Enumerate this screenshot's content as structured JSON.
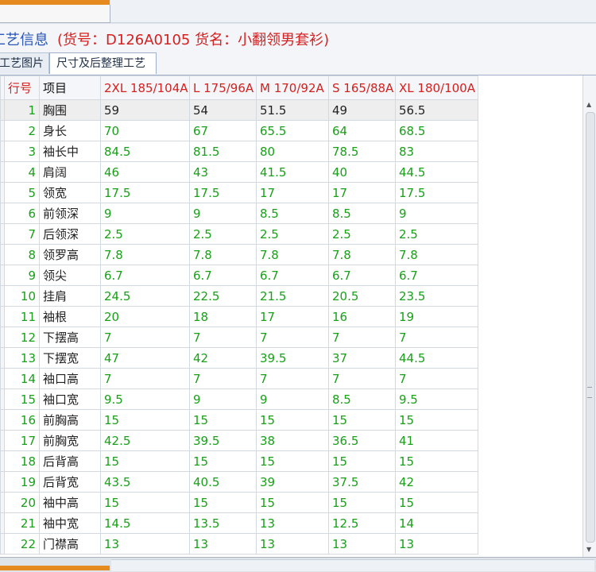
{
  "window": {
    "title_main": "工艺信息",
    "title_sub": "(货号：D126A0105 货名：小翻领男套衫)"
  },
  "tabs": [
    {
      "label": "工艺图片"
    },
    {
      "label": "尺寸及后整理工艺"
    }
  ],
  "grid": {
    "headers": [
      "行号",
      "项目",
      "2XL 185/104A",
      "L 175/96A",
      "M 170/92A",
      "S 165/88A",
      "XL 180/100A"
    ],
    "rows": [
      [
        "1",
        "胸围",
        "59",
        "54",
        "51.5",
        "49",
        "56.5"
      ],
      [
        "2",
        "身长",
        "70",
        "67",
        "65.5",
        "64",
        "68.5"
      ],
      [
        "3",
        "袖长中",
        "84.5",
        "81.5",
        "80",
        "78.5",
        "83"
      ],
      [
        "4",
        "肩阔",
        "46",
        "43",
        "41.5",
        "40",
        "44.5"
      ],
      [
        "5",
        "领宽",
        "17.5",
        "17.5",
        "17",
        "17",
        "17.5"
      ],
      [
        "6",
        "前领深",
        "9",
        "9",
        "8.5",
        "8.5",
        "9"
      ],
      [
        "7",
        "后领深",
        "2.5",
        "2.5",
        "2.5",
        "2.5",
        "2.5"
      ],
      [
        "8",
        "领罗高",
        "7.8",
        "7.8",
        "7.8",
        "7.8",
        "7.8"
      ],
      [
        "9",
        "领尖",
        "6.7",
        "6.7",
        "6.7",
        "6.7",
        "6.7"
      ],
      [
        "10",
        "挂肩",
        "24.5",
        "22.5",
        "21.5",
        "20.5",
        "23.5"
      ],
      [
        "11",
        "袖根",
        "20",
        "18",
        "17",
        "16",
        "19"
      ],
      [
        "12",
        "下摆高",
        "7",
        "7",
        "7",
        "7",
        "7"
      ],
      [
        "13",
        "下摆宽",
        "47",
        "42",
        "39.5",
        "37",
        "44.5"
      ],
      [
        "14",
        "袖口高",
        "7",
        "7",
        "7",
        "7",
        "7"
      ],
      [
        "15",
        "袖口宽",
        "9.5",
        "9",
        "9",
        "8.5",
        "9.5"
      ],
      [
        "16",
        "前胸高",
        "15",
        "15",
        "15",
        "15",
        "15"
      ],
      [
        "17",
        "前胸宽",
        "42.5",
        "39.5",
        "38",
        "36.5",
        "41"
      ],
      [
        "18",
        "后背高",
        "15",
        "15",
        "15",
        "15",
        "15"
      ],
      [
        "19",
        "后背宽",
        "43.5",
        "40.5",
        "39",
        "37.5",
        "42"
      ],
      [
        "20",
        "袖中高",
        "15",
        "15",
        "15",
        "15",
        "15"
      ],
      [
        "21",
        "袖中宽",
        "14.5",
        "13.5",
        "13",
        "12.5",
        "14"
      ],
      [
        "22",
        "门襟高",
        "13",
        "13",
        "13",
        "13",
        "13"
      ]
    ]
  },
  "colors": {
    "title_blue": "#2a56b7",
    "title_red": "#d52020",
    "value_green": "#18a018",
    "accent_orange": "#e58a1f"
  },
  "icons": {
    "scroll_up": "triangle-up-icon",
    "scroll_down": "triangle-down-icon"
  }
}
